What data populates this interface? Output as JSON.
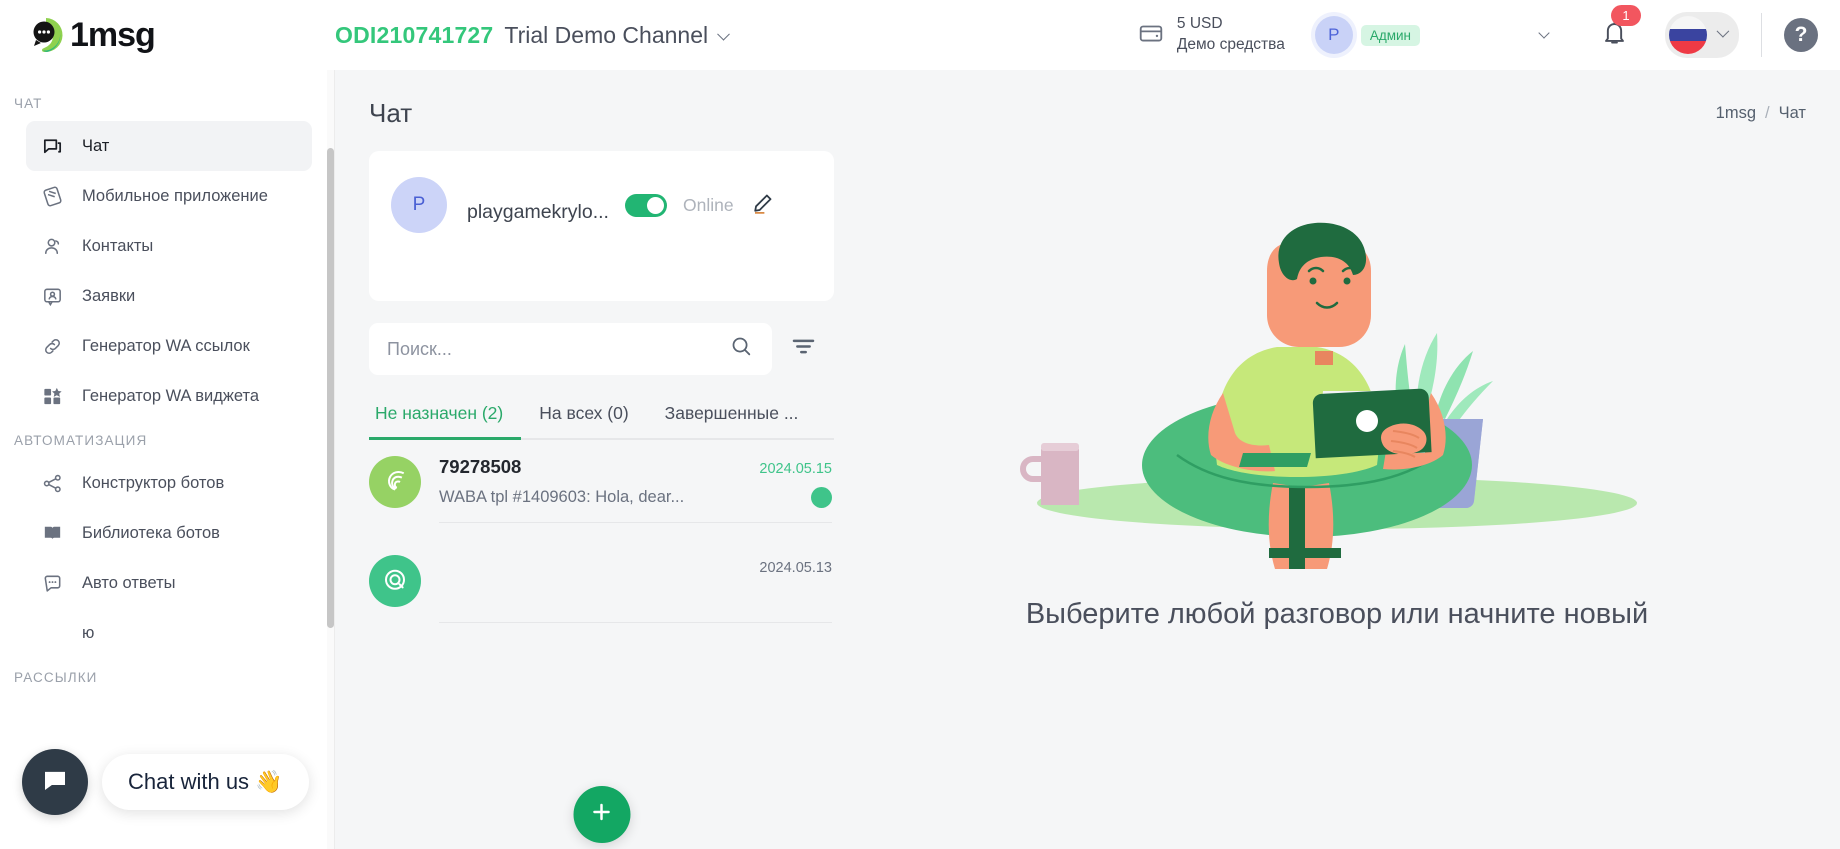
{
  "brand": {
    "name": "1msg",
    "logo_icon": "chat-bubble-logo"
  },
  "header": {
    "channel_id": "ODI210741727",
    "channel_name": "Trial Demo Channel",
    "channel_caret_icon": "chevron-down-icon",
    "wallet_icon": "wallet-icon",
    "wallet_amount": "5 USD",
    "wallet_label": "Демо средства",
    "avatar_initial": "P",
    "role_badge": "Админ",
    "user_caret_icon": "chevron-down-icon",
    "bell_icon": "bell-icon",
    "notification_count": "1",
    "flag_icon": "russia-flag-icon",
    "lang_caret_icon": "chevron-down-icon",
    "help_label": "?"
  },
  "sidebar": {
    "sections": [
      {
        "title": "ЧАТ",
        "items": [
          {
            "label": "Чат",
            "icon": "chat-icon",
            "active": true
          },
          {
            "label": "Мобильное приложение",
            "icon": "mobile-app-icon",
            "active": false
          },
          {
            "label": "Контакты",
            "icon": "contacts-icon",
            "active": false
          },
          {
            "label": "Заявки",
            "icon": "requests-icon",
            "active": false
          },
          {
            "label": "Генератор WA ссылок",
            "icon": "link-icon",
            "active": false
          },
          {
            "label": "Генератор WA виджета",
            "icon": "widget-icon",
            "active": false
          }
        ]
      },
      {
        "title": "АВТОМАТИЗАЦИЯ",
        "items": [
          {
            "label": "Конструктор ботов",
            "icon": "share-nodes-icon",
            "active": false
          },
          {
            "label": "Библиотека ботов",
            "icon": "book-icon",
            "active": false
          },
          {
            "label": "Авто ответы",
            "icon": "auto-reply-icon",
            "active": false
          },
          {
            "label": "ю",
            "icon": "hidden-icon",
            "active": false
          }
        ]
      },
      {
        "title": "РАССЫЛКИ",
        "items": []
      }
    ]
  },
  "chat_widget": {
    "label": "Chat with us 👋",
    "icon": "chat-widget-icon"
  },
  "main": {
    "page_title": "Чат",
    "breadcrumb": {
      "root": "1msg",
      "separator": "/",
      "current": "Чат"
    },
    "profile": {
      "avatar_initial": "P",
      "name": "playgamekrylo...",
      "online_label": "Online",
      "toggle_on": true,
      "edit_icon": "pencil-icon"
    },
    "search": {
      "placeholder": "Поиск...",
      "value": "",
      "icon": "search-icon",
      "filter_icon": "filter-icon"
    },
    "tabs": [
      {
        "label": "Не назначен (2)",
        "active": true
      },
      {
        "label": "На всех (0)",
        "active": false
      },
      {
        "label": "Завершенные ...",
        "active": false
      }
    ],
    "conversations": [
      {
        "avatar_icon": "spiral-avatar-icon",
        "name": "79278508",
        "preview": "WABA tpl #1409603: Hola, dear...",
        "date": "2024.05.15",
        "unread": true,
        "blurred": false
      },
      {
        "avatar_icon": "target-avatar-icon",
        "name": "",
        "preview": "",
        "date": "2024.05.13",
        "unread": false,
        "blurred": true
      }
    ],
    "new_chat_icon": "plus-icon",
    "empty_state": {
      "text": "Выберите любой разговор или начните новый",
      "illustration": "person-with-laptop-illustration"
    }
  },
  "colors": {
    "accent_green": "#2aa96a",
    "brand_green": "#34c77b",
    "fab_green": "#13a763",
    "badge_red": "#f2565f",
    "text_dark": "#3e444f",
    "text_muted": "#6b7280",
    "panel_bg": "#f5f6f7"
  }
}
